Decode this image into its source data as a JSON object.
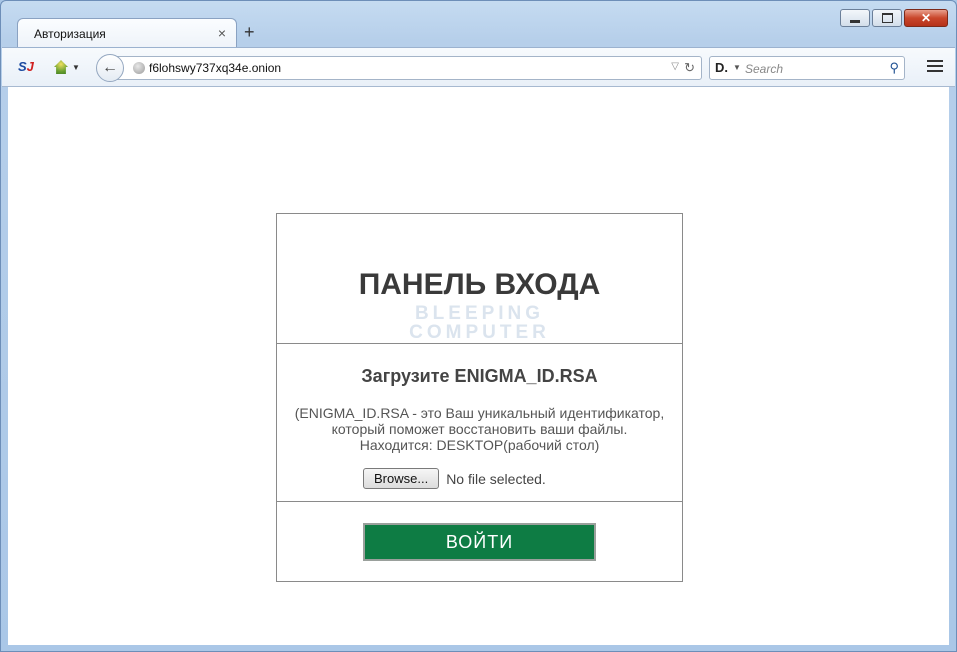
{
  "browser": {
    "tab": {
      "title": "Авторизация",
      "close": "×"
    },
    "new_tab": "+",
    "toolbar": {
      "si_logo": "S",
      "si_logo_accent": "J"
    },
    "url": "f6lohswy737xq34e.onion",
    "search": {
      "engine_logo": "D.",
      "placeholder": "Search"
    }
  },
  "page": {
    "title": "ПАНЕЛЬ ВХОДА",
    "watermark_line1": "BLEEPING",
    "watermark_line2": "COMPUTER",
    "upload_title": "Загрузите ENIGMA_ID.RSA",
    "upload_desc_line1": "(ENIGMA_ID.RSA - это Ваш уникальный идентификатор,",
    "upload_desc_line2": "который поможет восстановить ваши файлы.",
    "upload_desc_line3": "Находится: DESKTOP(рабочий стол)",
    "browse_label": "Browse...",
    "file_status": "No file selected.",
    "login_label": "ВОЙТИ"
  },
  "colors": {
    "login_button": "#0e7c44",
    "window_frame": "#a9c6e6"
  }
}
